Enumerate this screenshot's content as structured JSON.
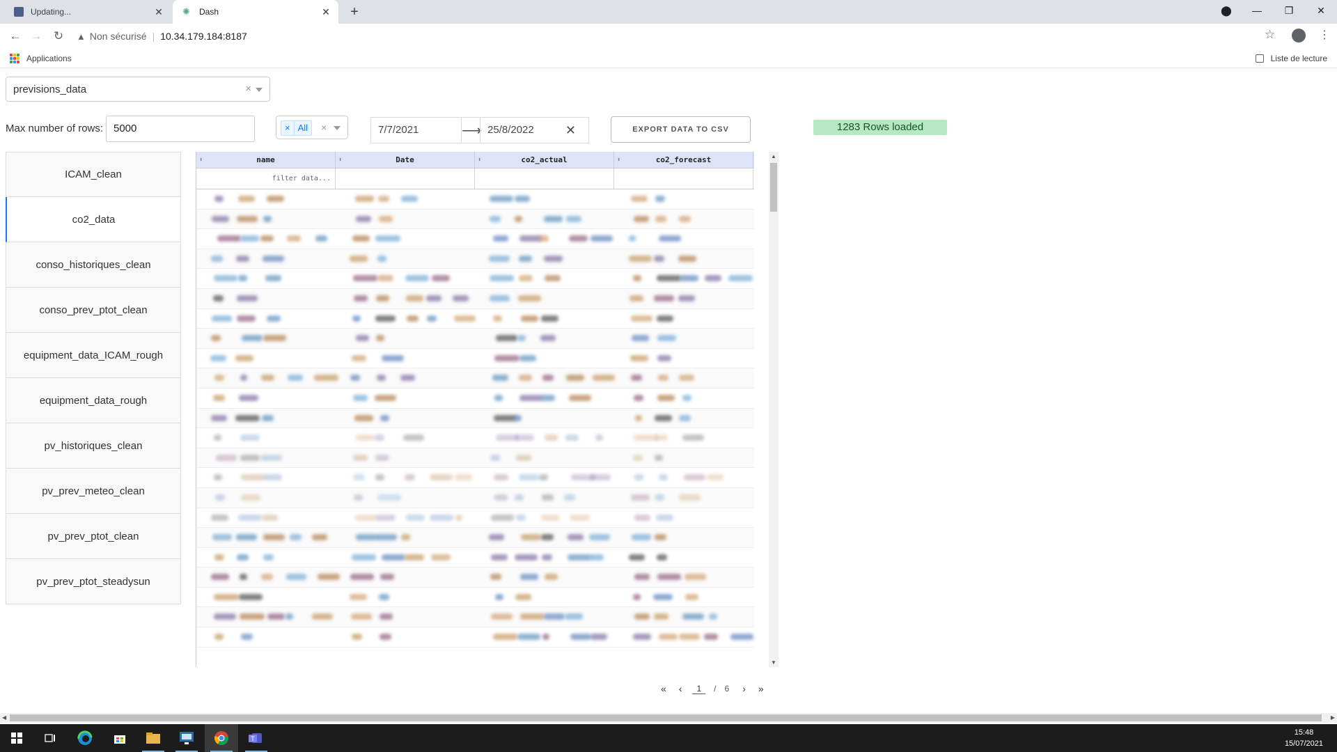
{
  "browser": {
    "tabs": [
      {
        "title": "Updating...",
        "active": false
      },
      {
        "title": "Dash",
        "active": true
      }
    ],
    "address": {
      "security_label": "Non sécurisé",
      "url": "10.34.179.184:8187"
    },
    "bookmarks": {
      "apps_label": "Applications",
      "reading_list_label": "Liste de lecture"
    }
  },
  "dataset_dropdown": {
    "value": "previsions_data"
  },
  "max_rows": {
    "label": "Max number of rows:",
    "value": "5000"
  },
  "filter_select": {
    "chip_label": "All",
    "chip_remove": "×",
    "clear": "×"
  },
  "date_range": {
    "start": "7/7/2021",
    "end": "25/8/2022"
  },
  "export_button": {
    "label": "EXPORT DATA TO CSV"
  },
  "status": {
    "text": "1283 Rows loaded",
    "color": "#b8e8c2"
  },
  "sidebar": {
    "items": [
      {
        "label": "ICAM_clean",
        "active": false
      },
      {
        "label": "co2_data",
        "active": true
      },
      {
        "label": "conso_historiques_clean",
        "active": false
      },
      {
        "label": "conso_prev_ptot_clean",
        "active": false
      },
      {
        "label": "equipment_data_ICAM_rough",
        "active": false
      },
      {
        "label": "equipment_data_rough",
        "active": false
      },
      {
        "label": "pv_historiques_clean",
        "active": false
      },
      {
        "label": "pv_prev_meteo_clean",
        "active": false
      },
      {
        "label": "pv_prev_ptot_clean",
        "active": false
      },
      {
        "label": "pv_prev_ptot_steadysun",
        "active": false
      }
    ]
  },
  "table": {
    "columns": [
      "name",
      "Date",
      "co2_actual",
      "co2_forecast"
    ],
    "filter_placeholder": "filter data...",
    "header_color": "#dfe3f8"
  },
  "pagination": {
    "first": "«",
    "prev": "‹",
    "current": "1",
    "separator": "/",
    "total": "6",
    "next": "›",
    "last": "»"
  },
  "taskbar": {
    "time": "15:48",
    "date": "15/07/2021"
  },
  "colors": {
    "accent": "#1975fa",
    "chip": "#007eff"
  }
}
